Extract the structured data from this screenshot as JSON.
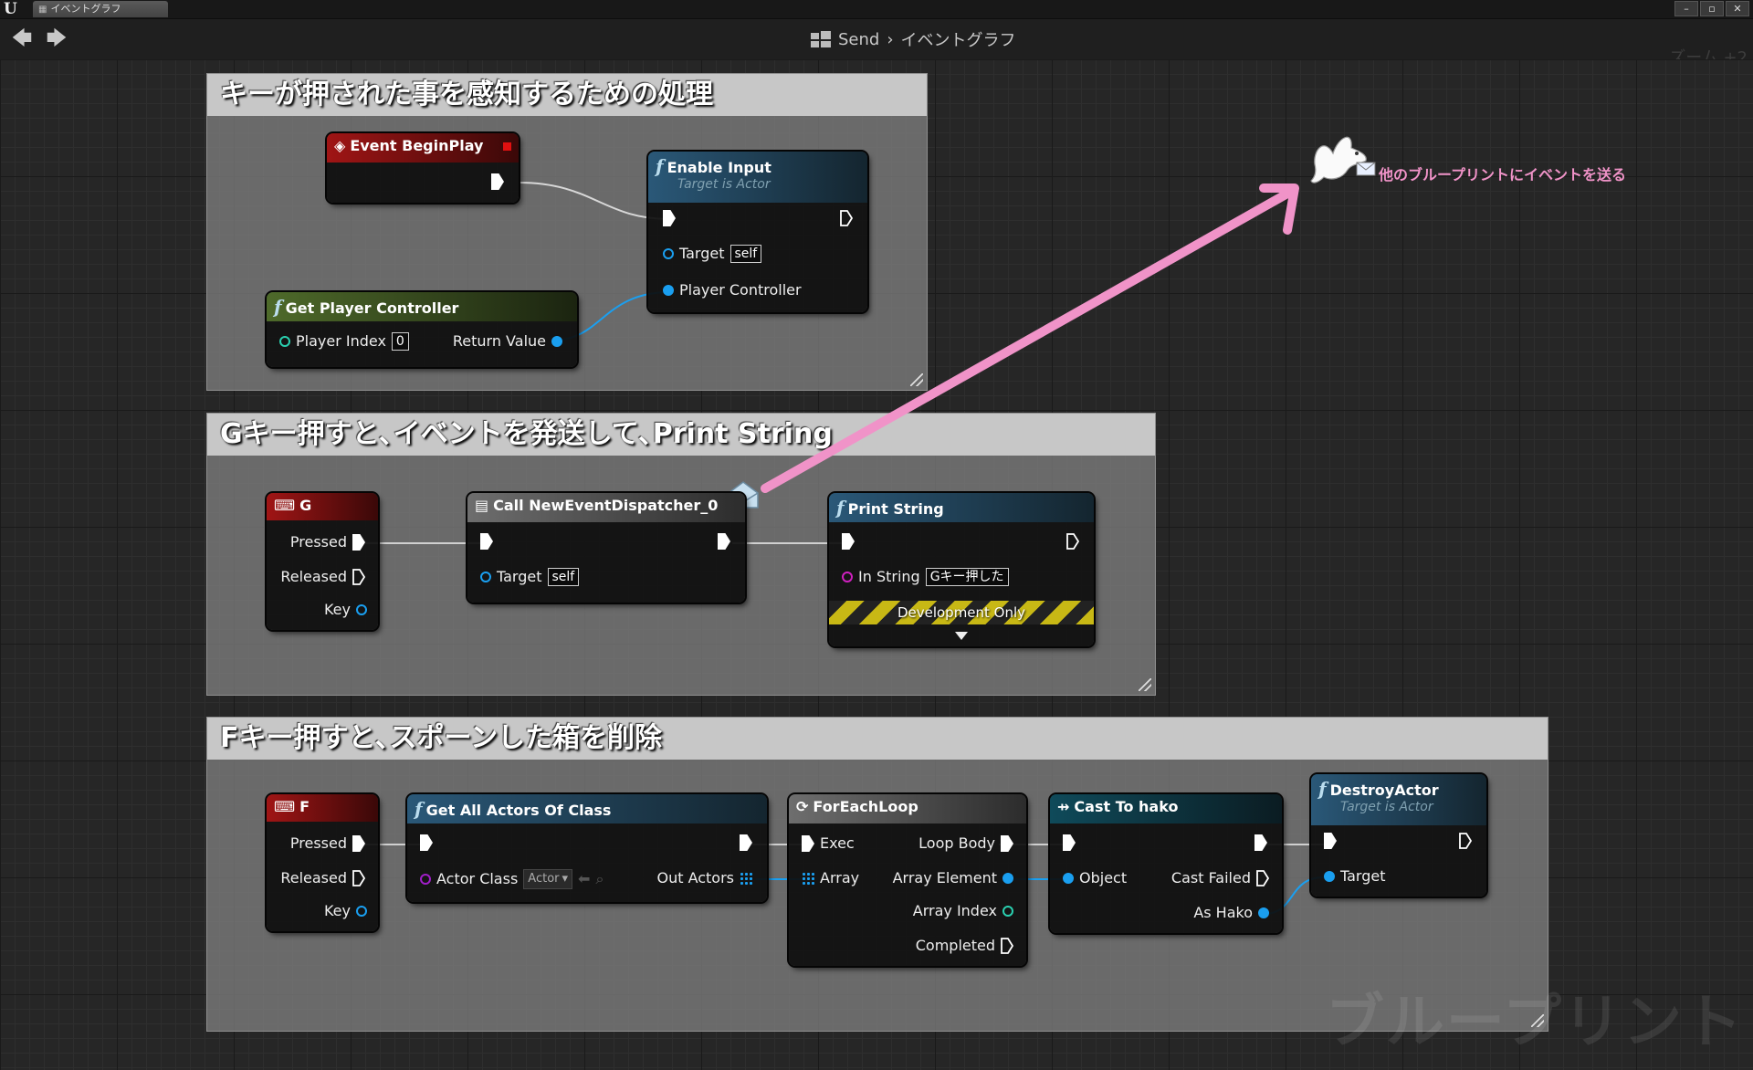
{
  "window": {
    "tab_title": "イベントグラフ",
    "controls": [
      "–",
      "▫",
      "✕"
    ]
  },
  "toolbar": {
    "back_icon": "arrow-left-icon",
    "forward_icon": "arrow-right-icon",
    "breadcrumb": {
      "blueprint": "Send",
      "separator": "›",
      "graph": "イベントグラフ"
    },
    "zoom": "ズーム +2"
  },
  "comments": [
    {
      "title": "キーが押された事を感知するための処理"
    },
    {
      "title": "Gキー押すと､イベントを発送して､Print String"
    },
    {
      "title": "Fキー押すと､スポーンした箱を削除"
    }
  ],
  "nodes": {
    "event_beginplay": {
      "title": "Event BeginPlay"
    },
    "enable_input": {
      "title": "Enable Input",
      "subtitle": "Target is Actor",
      "target_label": "Target",
      "target_value": "self",
      "pc_label": "Player Controller"
    },
    "get_player_controller": {
      "title": "Get Player Controller",
      "index_label": "Player Index",
      "index_value": "0",
      "return_label": "Return Value"
    },
    "g_key": {
      "title": "G",
      "pressed": "Pressed",
      "released": "Released",
      "key": "Key"
    },
    "call_dispatcher": {
      "title": "Call NewEventDispatcher_0",
      "target_label": "Target",
      "target_value": "self"
    },
    "print_string": {
      "title": "Print String",
      "in_string_label": "In String",
      "in_string_value": "Gキー押した",
      "dev_only": "Development Only"
    },
    "f_key": {
      "title": "F",
      "pressed": "Pressed",
      "released": "Released",
      "key": "Key"
    },
    "get_all_actors": {
      "title": "Get All Actors Of Class",
      "actor_class_label": "Actor Class",
      "actor_class_value": "Actor",
      "out_label": "Out Actors"
    },
    "foreach": {
      "title": "ForEachLoop",
      "exec": "Exec",
      "loop_body": "Loop Body",
      "array": "Array",
      "array_element": "Array Element",
      "array_index": "Array Index",
      "completed": "Completed"
    },
    "cast": {
      "title": "Cast To hako",
      "object": "Object",
      "cast_failed": "Cast Failed",
      "as_hako": "As Hako"
    },
    "destroy": {
      "title": "DestroyActor",
      "subtitle": "Target is Actor",
      "target": "Target"
    }
  },
  "annotation": {
    "text": "他のブループリントにイベントを送る",
    "icon": "dove-with-envelope-icon",
    "arrow_color": "#f093c8"
  },
  "watermark": "ブループリント",
  "colors": {
    "exec": "#ffffff",
    "object_pin": "#1a9ff0",
    "int_pin": "#2ad0b0",
    "class_pin": "#a01ec8",
    "string_pin": "#d020c0",
    "annotation": "#f093c8"
  }
}
